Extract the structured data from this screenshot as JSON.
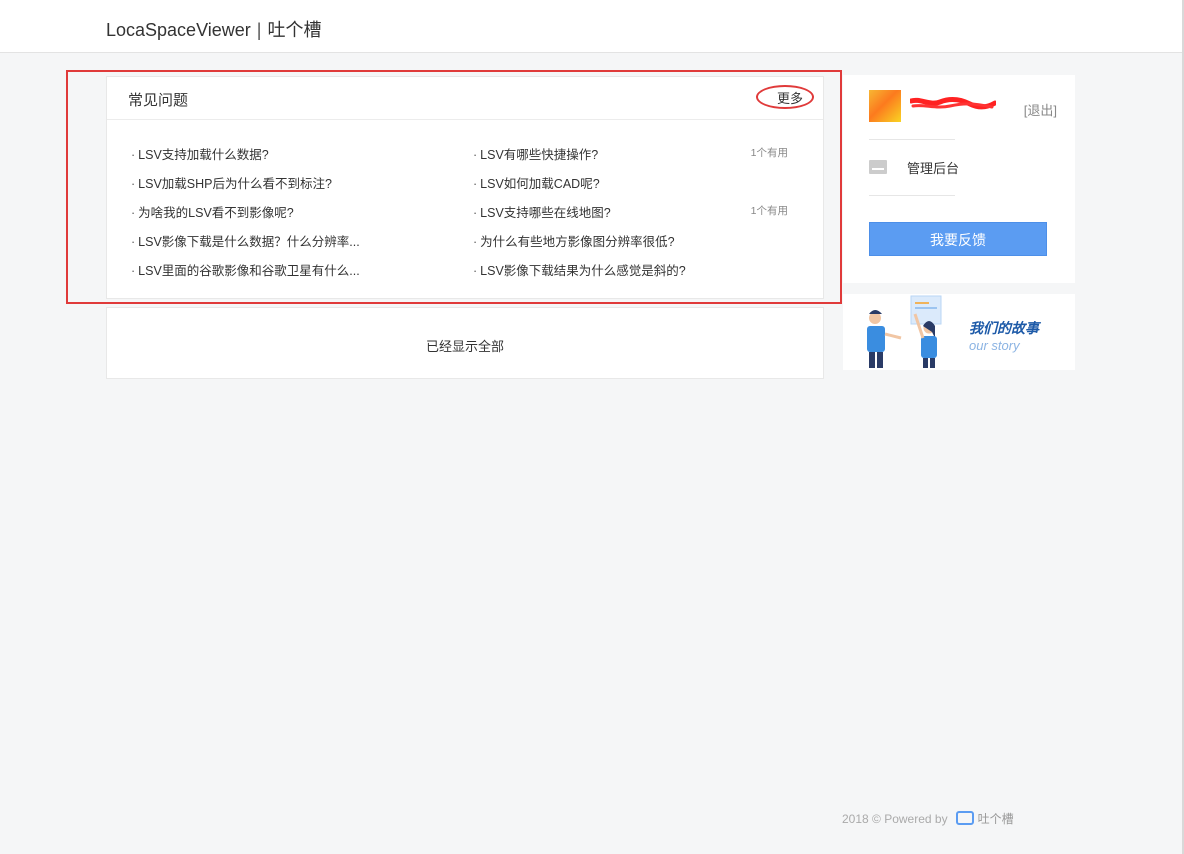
{
  "header": {
    "app_name": "LocaSpaceViewer",
    "separator": "|",
    "site_name": "吐个槽"
  },
  "faq": {
    "title": "常见问题",
    "more_label": "更多",
    "rows": [
      {
        "left": "LSV支持加载什么数据?",
        "right": "LSV有哪些快捷操作?",
        "useful": "1个有用"
      },
      {
        "left": "LSV加载SHP后为什么看不到标注?",
        "right": "LSV如何加载CAD呢?",
        "useful": ""
      },
      {
        "left": "为啥我的LSV看不到影像呢?",
        "right": "LSV支持哪些在线地图?",
        "useful": "1个有用"
      },
      {
        "left": "LSV影像下载是什么数据？什么分辨率...",
        "right": "为什么有些地方影像图分辨率很低?",
        "useful": ""
      },
      {
        "left": "LSV里面的谷歌影像和谷歌卫星有什么...",
        "right": "LSV影像下载结果为什么感觉是斜的?",
        "useful": ""
      }
    ]
  },
  "shown_all": "已经显示全部",
  "sidebar": {
    "logout": "[退出]",
    "admin_label": "管理后台",
    "feedback_button": "我要反馈"
  },
  "story": {
    "title": "我们的故事",
    "subtitle": "our story"
  },
  "footer": {
    "copyright": "2018 © Powered by",
    "brand": "吐个槽"
  },
  "colors": {
    "accent": "#5b9cf2",
    "highlight_annotation": "#e03a3a",
    "background": "#f5f6f7"
  }
}
